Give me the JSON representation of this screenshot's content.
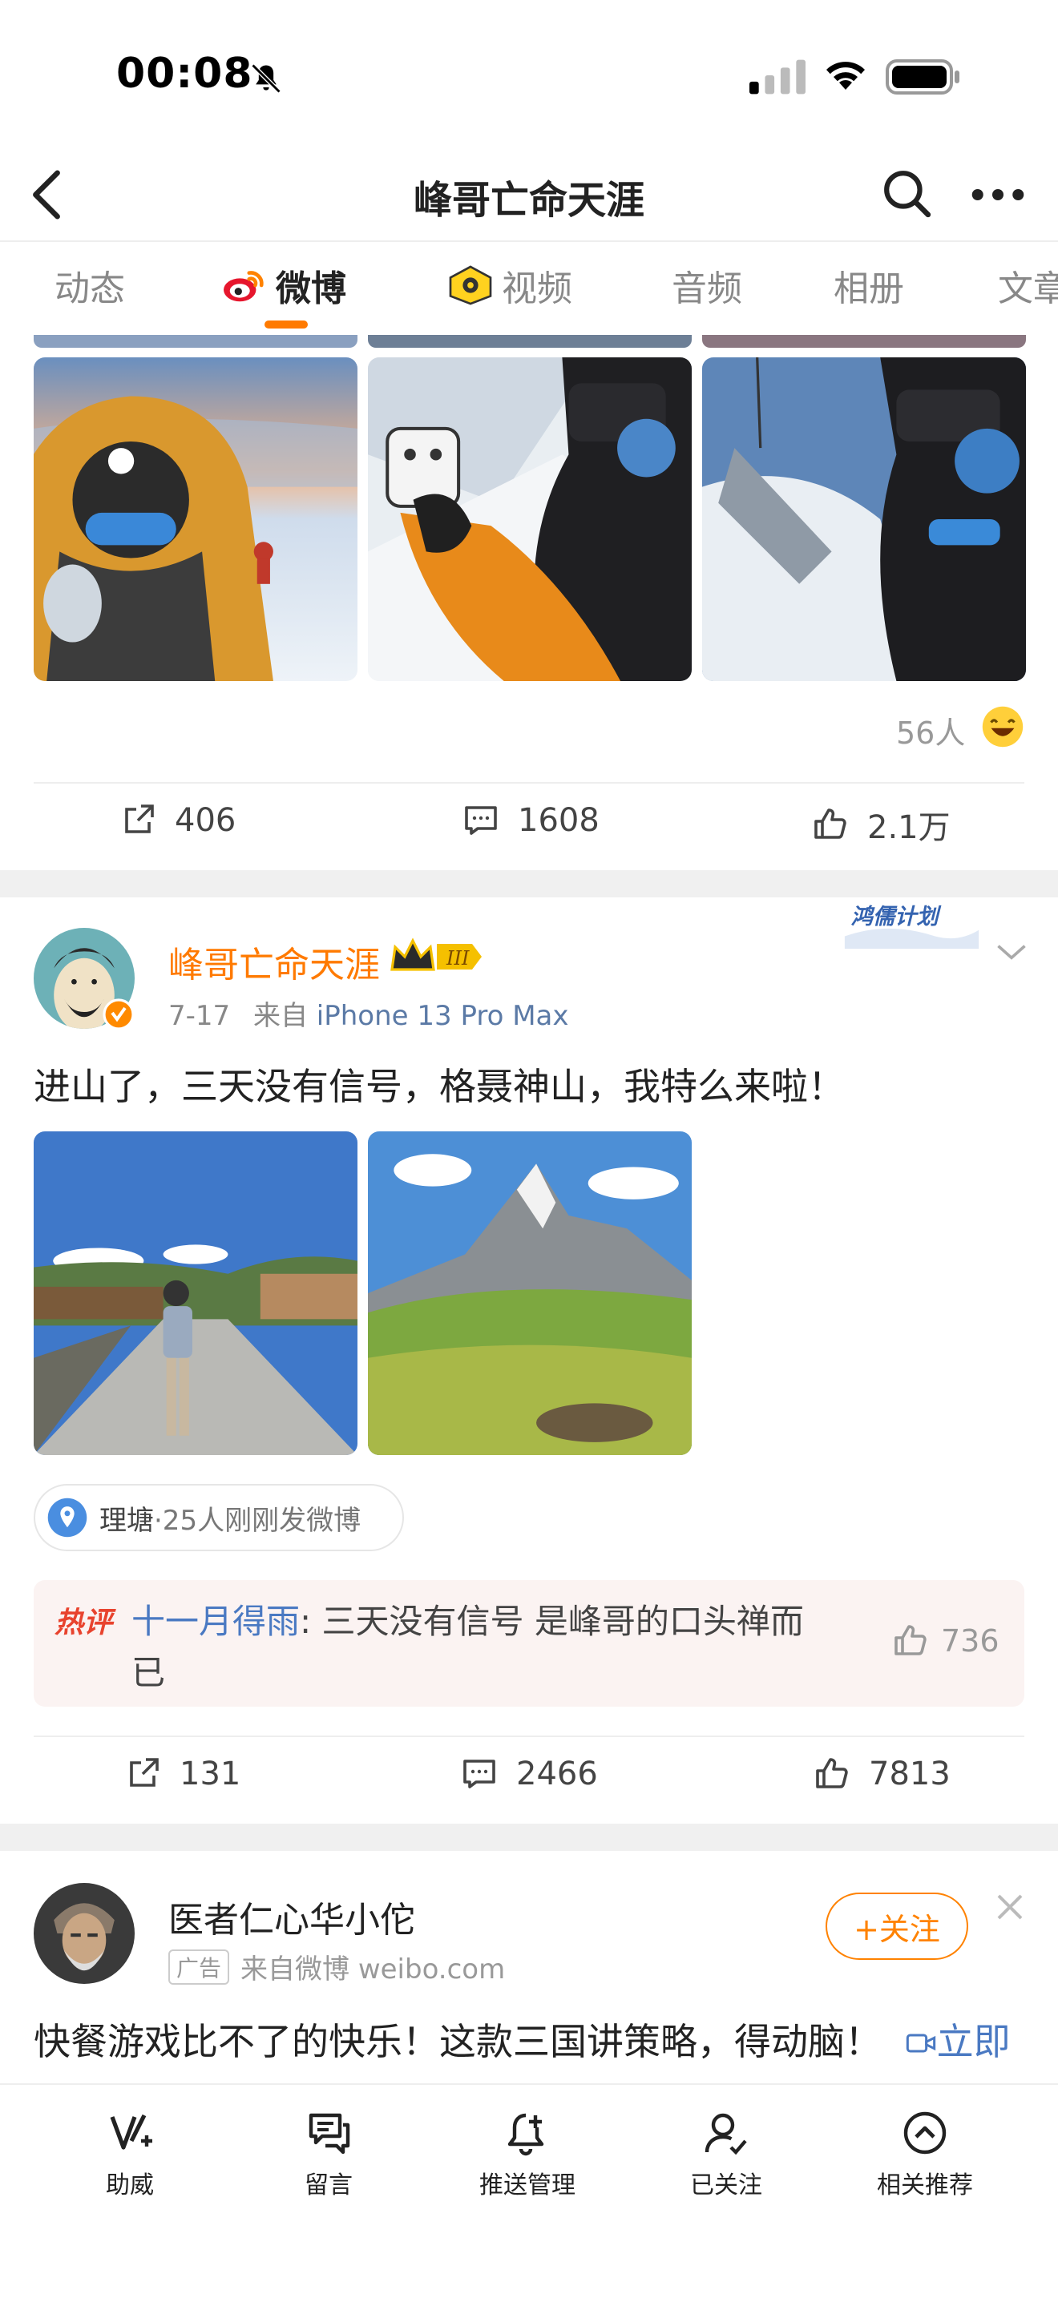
{
  "status_bar": {
    "time": "00:08"
  },
  "nav": {
    "title": "峰哥亡命天涯"
  },
  "tabs": [
    {
      "label": "动态"
    },
    {
      "label": "微博"
    },
    {
      "label": "视频"
    },
    {
      "label": "音频"
    },
    {
      "label": "相册"
    },
    {
      "label": "文章"
    }
  ],
  "post1": {
    "reaction": "56人",
    "reposts": "406",
    "comments": "1608",
    "likes": "2.1万"
  },
  "post2": {
    "author": "峰哥亡命天涯",
    "date": "7-17",
    "source_prefix": "来自",
    "source": "iPhone 13 Pro Max",
    "banner": "鸿儒计划",
    "text": "进山了，三天没有信号，格聂神山，我特么来啦！",
    "location_name": "理塘",
    "location_extra": "·25人刚刚发微博",
    "hot_tag": "热评",
    "hot_user": "十一月得雨",
    "hot_text": ": 三天没有信号 是峰哥的口头禅而已",
    "hot_likes": "736",
    "reposts": "131",
    "comments": "2466",
    "likes": "7813"
  },
  "ad": {
    "name": "医者仁心华小佗",
    "tag": "广告",
    "source": "来自微博 weibo.com",
    "follow_label": "+关注",
    "text": "快餐游戏比不了的快乐！这款三国讲策略，得动脑！",
    "link": "立即下载"
  },
  "bottom_bar": [
    {
      "label": "助威",
      "icon": "cheer-icon"
    },
    {
      "label": "留言",
      "icon": "message-icon"
    },
    {
      "label": "推送管理",
      "icon": "bell-plus-icon"
    },
    {
      "label": "已关注",
      "icon": "user-check-icon"
    },
    {
      "label": "相关推荐",
      "icon": "up-circle-icon"
    }
  ]
}
